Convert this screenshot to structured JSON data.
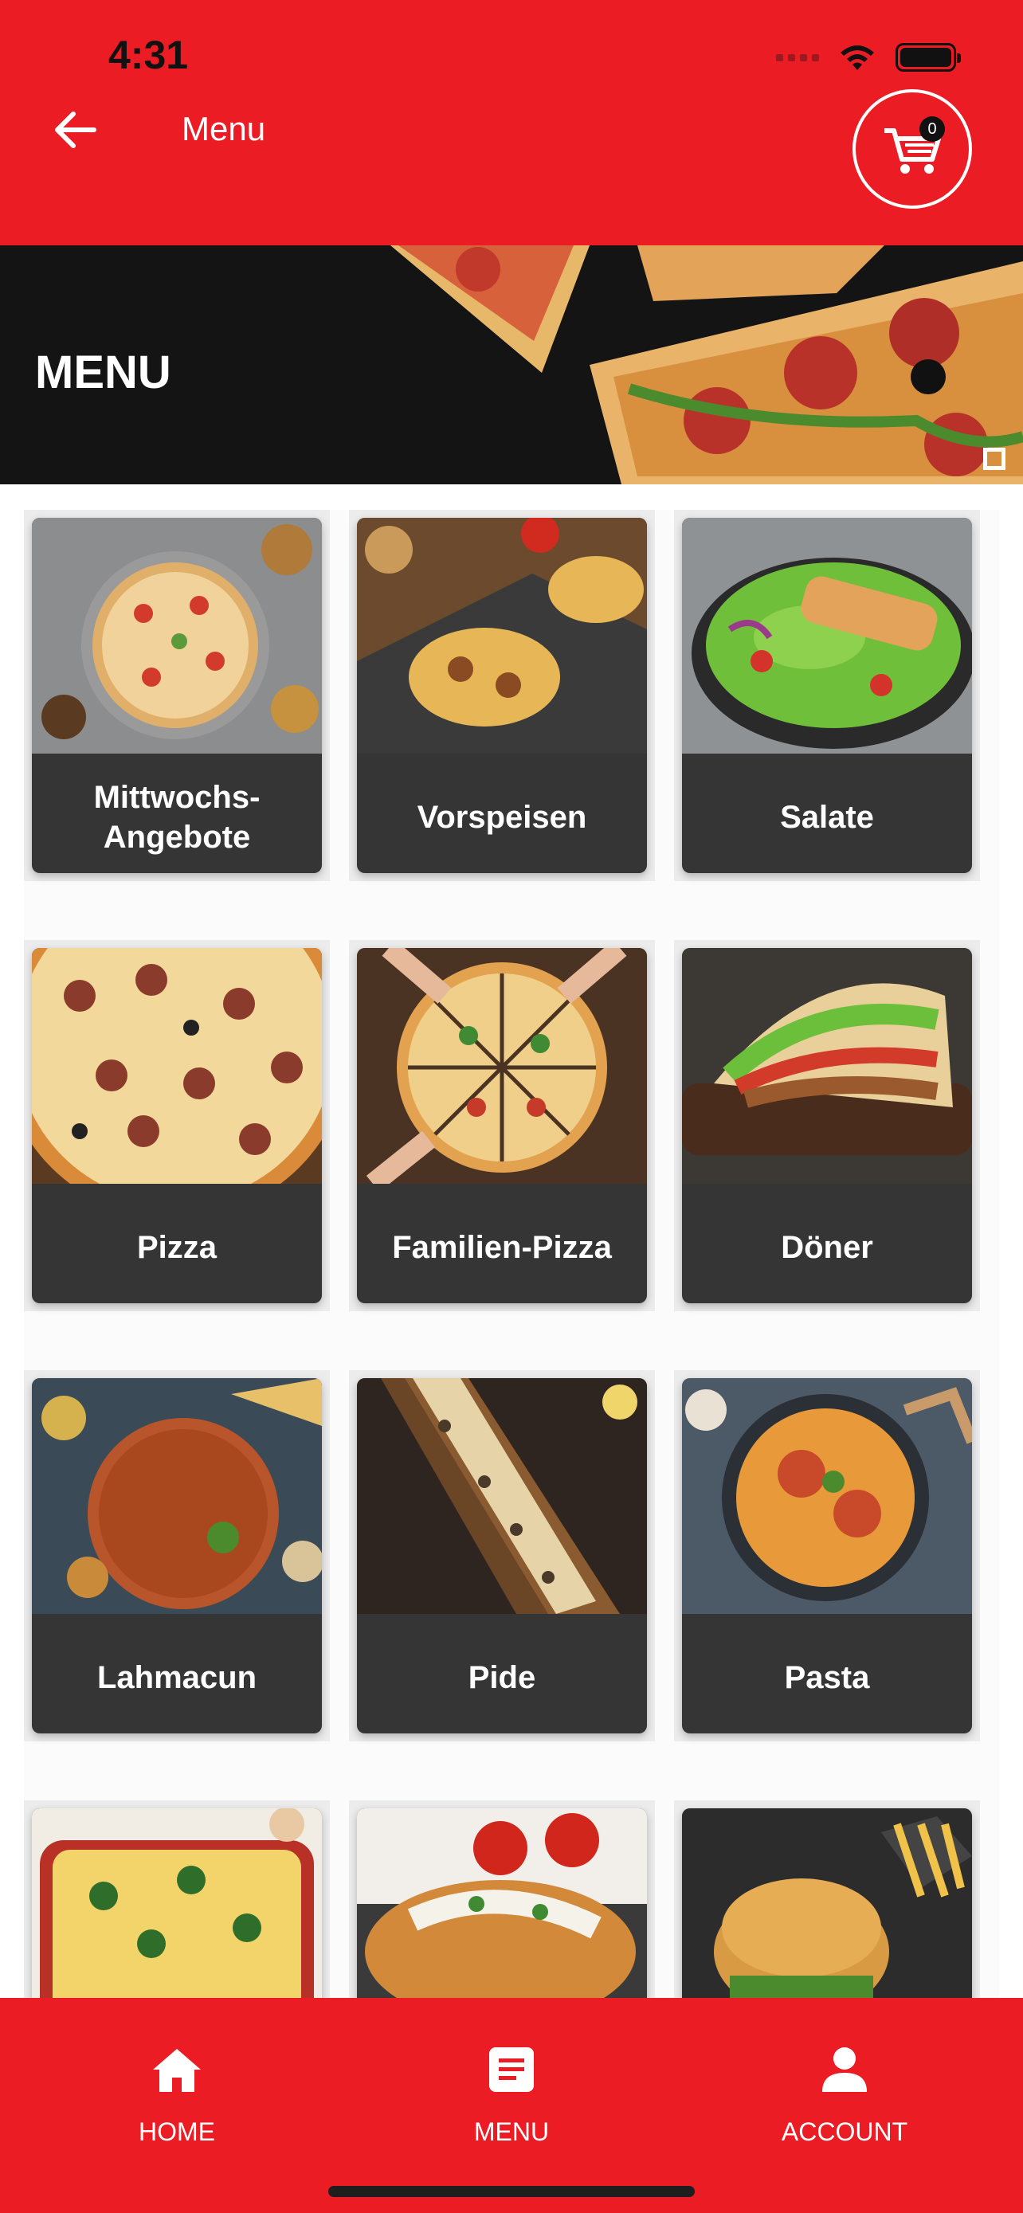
{
  "status_bar": {
    "time": "4:31"
  },
  "header": {
    "title": "Menu",
    "cart_count": "0"
  },
  "banner": {
    "title": "MENU"
  },
  "categories": [
    {
      "label": "Mittwochs-Angebote"
    },
    {
      "label": "Vorspeisen"
    },
    {
      "label": "Salate"
    },
    {
      "label": "Pizza"
    },
    {
      "label": "Familien-Pizza"
    },
    {
      "label": "Döner"
    },
    {
      "label": "Lahmacun"
    },
    {
      "label": "Pide"
    },
    {
      "label": "Pasta"
    },
    {
      "label": ""
    },
    {
      "label": ""
    },
    {
      "label": ""
    }
  ],
  "bottom_nav": {
    "items": [
      {
        "label": "HOME",
        "icon": "home-icon"
      },
      {
        "label": "MENU",
        "icon": "menu-list-icon"
      },
      {
        "label": "ACCOUNT",
        "icon": "account-icon"
      }
    ]
  },
  "colors": {
    "brand_red": "#ec1c24",
    "card_dark": "#353535"
  }
}
